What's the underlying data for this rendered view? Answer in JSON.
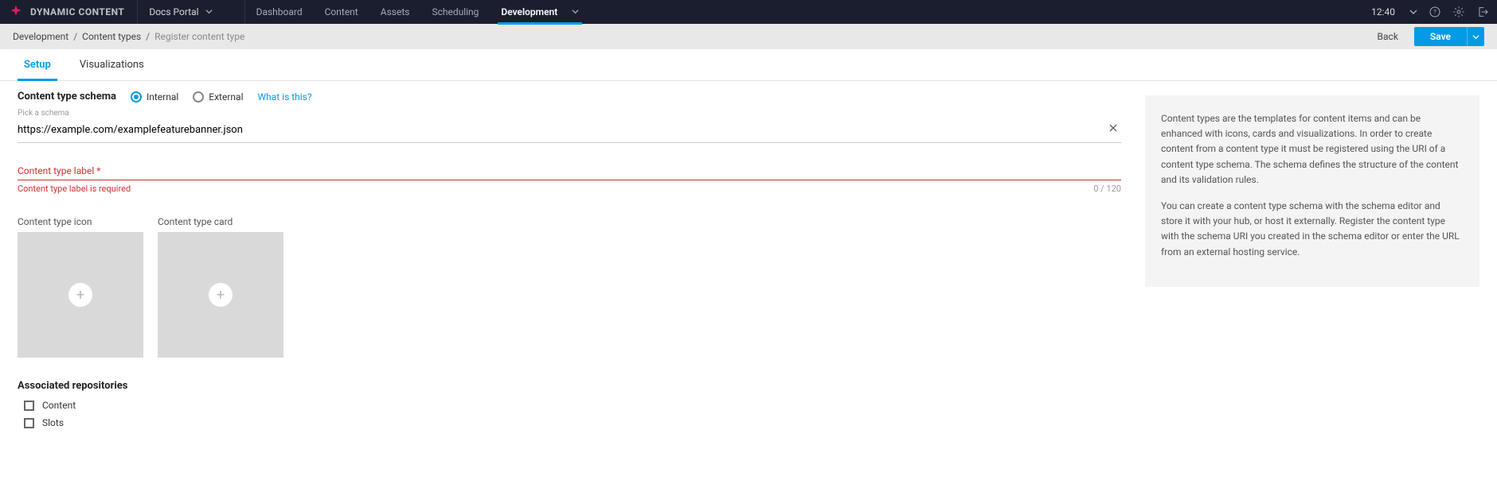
{
  "brand": "DYNAMIC CONTENT",
  "topnav": {
    "docs": "Docs Portal",
    "items": [
      "Dashboard",
      "Content",
      "Assets",
      "Scheduling",
      "Development"
    ],
    "activeIndex": 4
  },
  "time": "12:40",
  "breadcrumb": {
    "items": [
      "Development",
      "Content types",
      "Register content type"
    ]
  },
  "actions": {
    "back": "Back",
    "save": "Save"
  },
  "tabs": {
    "items": [
      "Setup",
      "Visualizations"
    ],
    "activeIndex": 0
  },
  "schema": {
    "section_label": "Content type schema",
    "options": {
      "internal": "Internal",
      "external": "External"
    },
    "selected": "internal",
    "whatis": "What is this?",
    "hint": "Pick a schema",
    "value": "https://example.com/examplefeaturebanner.json"
  },
  "labelField": {
    "label": "Content type label *",
    "error": "Content type label is required",
    "counter": "0 / 120"
  },
  "uploads": {
    "icon_label": "Content type icon",
    "card_label": "Content type card"
  },
  "repos": {
    "title": "Associated repositories",
    "items": [
      "Content",
      "Slots"
    ]
  },
  "help": {
    "p1": "Content types are the templates for content items and can be enhanced with icons, cards and visualizations. In order to create content from a content type it must be registered using the URI of a content type schema. The schema defines the structure of the content and its validation rules.",
    "p2": "You can create a content type schema with the schema editor and store it with your hub, or host it externally. Register the content type with the schema URI you created in the schema editor or enter the URL from an external hosting service."
  }
}
